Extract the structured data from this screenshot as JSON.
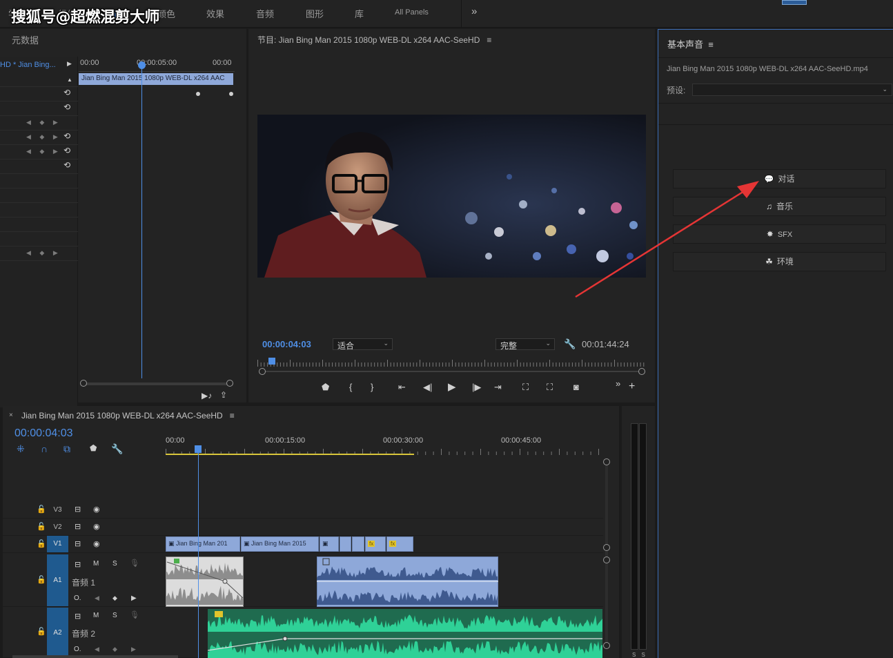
{
  "watermark": "搜狐号@超燃混剪大师",
  "workspaces": {
    "tabs": [
      {
        "label": "学"
      },
      {
        "label": "组件"
      },
      {
        "label": "编辑"
      },
      {
        "label": "颜色"
      },
      {
        "label": "效果"
      },
      {
        "label": "音频"
      },
      {
        "label": "图形"
      },
      {
        "label": "库"
      },
      {
        "label": "All Panels"
      }
    ],
    "more": "»"
  },
  "effect_controls": {
    "title": "元数据",
    "clip_name": "HD * Jian Bing...",
    "ruler": [
      "00:00",
      "00:00:05:00",
      "00:00"
    ],
    "clip_bar": "Jian Bing Man 2015 1080p WEB-DL x264 AAC",
    "reset_glyph": "⟲",
    "kf_glyph": "◀ ◆ ▶"
  },
  "program_monitor": {
    "title": "节目: Jian Bing Man 2015 1080p WEB-DL x264 AAC-SeeHD",
    "menu": "≡",
    "timecode": "00:00:04:03",
    "fit": "适合",
    "quality": "完整",
    "duration": "00:01:44:24"
  },
  "essential_sound": {
    "title": "基本声音",
    "menu": "≡",
    "file": "Jian Bing Man 2015 1080p WEB-DL x264 AAC-SeeHD.mp4",
    "preset_label": "预设:",
    "preset_value": "",
    "buttons": [
      {
        "label": "对话",
        "icon": "speech-bubble-icon",
        "glyph": "💬"
      },
      {
        "label": "音乐",
        "icon": "music-note-icon",
        "glyph": "♫"
      },
      {
        "label": "SFX",
        "icon": "burst-icon",
        "glyph": "✸"
      },
      {
        "label": "环境",
        "icon": "leaf-icon",
        "glyph": "☘"
      }
    ]
  },
  "timeline": {
    "close": "×",
    "title": "Jian Bing Man 2015 1080p WEB-DL x264 AAC-SeeHD",
    "menu": "≡",
    "timecode": "00:00:04:03",
    "ruler": [
      "00:00",
      "00:00:15:00",
      "00:00:30:00",
      "00:00:45:00"
    ],
    "tracks": [
      {
        "id": "V3",
        "label": ""
      },
      {
        "id": "V2",
        "label": ""
      },
      {
        "id": "V1",
        "label": ""
      },
      {
        "id": "A1",
        "label": "音频 1"
      },
      {
        "id": "A2",
        "label": "音频 2"
      }
    ],
    "clips_v1": [
      "Jian Bing Man 201",
      "Jian Bing Man 2015"
    ],
    "fx_badge": "fx",
    "track_m": "M",
    "track_s": "S"
  },
  "audio_meter": {
    "label": "S S"
  },
  "annotation": {
    "color": "#e53535"
  }
}
